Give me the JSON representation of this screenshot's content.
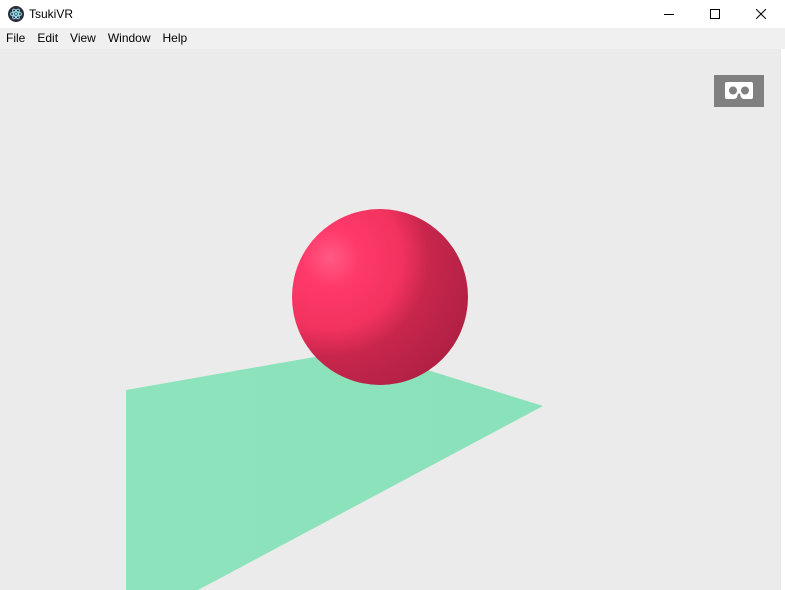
{
  "window": {
    "title": "TsukiVR",
    "app_icon": "electron-atom-icon",
    "controls": {
      "minimize_icon": "minimize-icon",
      "maximize_icon": "maximize-icon",
      "close_icon": "close-icon"
    }
  },
  "menubar": {
    "items": [
      {
        "label": "File"
      },
      {
        "label": "Edit"
      },
      {
        "label": "View"
      },
      {
        "label": "Window"
      },
      {
        "label": "Help"
      }
    ]
  },
  "viewport": {
    "background_color": "#ebebeb",
    "vr_button_icon": "vr-headset-icon",
    "vr_button_color": "#808080",
    "scene": {
      "sphere_color": "#ff3366",
      "plane_color": "#8ce3bb"
    }
  }
}
